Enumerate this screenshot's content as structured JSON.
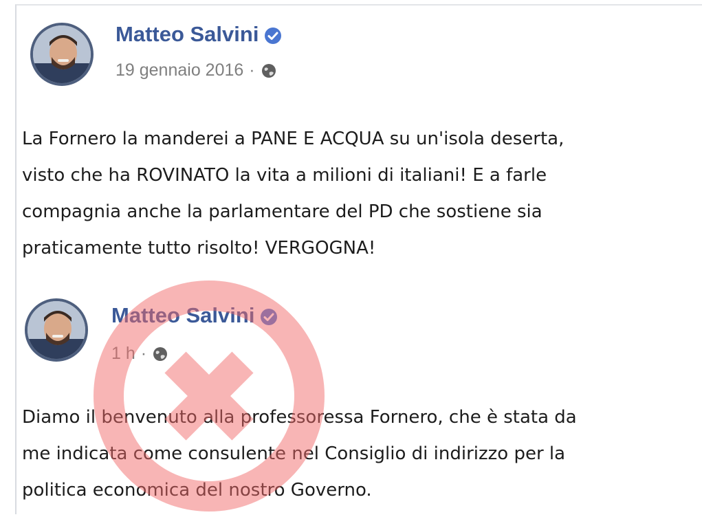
{
  "posts": [
    {
      "author": "Matteo Salvini",
      "timestamp": "19 gennaio 2016",
      "separator": "·",
      "text_lines": [
        "La Fornero la manderei a PANE E ACQUA su un'isola deserta,",
        "visto che ha ROVINATO la vita a milioni di italiani!  E a farle",
        "compagnia anche la parlamentare del PD che sostiene sia",
        "praticamente tutto risolto! VERGOGNA!"
      ]
    },
    {
      "author": "Matteo Salvini",
      "timestamp": "1 h",
      "separator": "·",
      "text_lines": [
        "Diamo il benvenuto alla professoressa Fornero, che è stata da",
        "me indicata come consulente nel Consiglio di indirizzo per la",
        "politica economica del nostro Governo."
      ]
    }
  ],
  "icons": {
    "verified": "verified-badge-icon",
    "audience": "globe-icon",
    "overlay": "red-x-circle-icon"
  },
  "colors": {
    "author": "#3b5998",
    "verified": "#4a76d1",
    "meta": "#7f7f7f",
    "overlay": "#f06a6a"
  }
}
